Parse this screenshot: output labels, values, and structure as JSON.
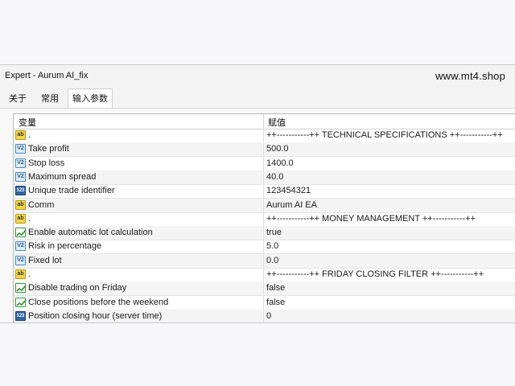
{
  "window": {
    "title": "Expert - Aurum AI_fix",
    "watermark": "www.mt4.shop"
  },
  "tabs": [
    {
      "label": "关于"
    },
    {
      "label": "常用"
    },
    {
      "label": "输入参数"
    }
  ],
  "active_tab": "输入参数",
  "table": {
    "headers": {
      "variable": "变量",
      "value": "赋值"
    },
    "rows": [
      {
        "icon": "ab-string-icon",
        "name": ".",
        "value": "++-----------++    TECHNICAL SPECIFICATIONS    ++-----------++"
      },
      {
        "icon": "numeric-icon",
        "name": "Take profit",
        "value": "500.0"
      },
      {
        "icon": "numeric-icon",
        "name": "Stop loss",
        "value": "1400.0"
      },
      {
        "icon": "numeric-icon",
        "name": "Maximum spread",
        "value": "40.0"
      },
      {
        "icon": "integer-icon",
        "name": "Unique trade identifier",
        "value": "123454321"
      },
      {
        "icon": "ab-string-icon",
        "name": "Comm",
        "value": "Aurum AI EA"
      },
      {
        "icon": "ab-string-icon",
        "name": ".",
        "value": "++-----------++    MONEY MANAGEMENT    ++-----------++"
      },
      {
        "icon": "boolean-icon",
        "name": "Enable automatic lot calculation",
        "value": "true"
      },
      {
        "icon": "numeric-icon",
        "name": "Risk in percentage",
        "value": "5.0"
      },
      {
        "icon": "numeric-icon",
        "name": "Fixed lot",
        "value": "0.0"
      },
      {
        "icon": "ab-string-icon",
        "name": ".",
        "value": "++-----------++    FRIDAY CLOSING FILTER    ++-----------++"
      },
      {
        "icon": "boolean-icon",
        "name": "Disable trading on Friday",
        "value": "false"
      },
      {
        "icon": "boolean-icon",
        "name": "Close positions before the weekend",
        "value": "false"
      },
      {
        "icon": "integer-icon",
        "name": "Position closing hour (server time)",
        "value": "0"
      }
    ]
  }
}
